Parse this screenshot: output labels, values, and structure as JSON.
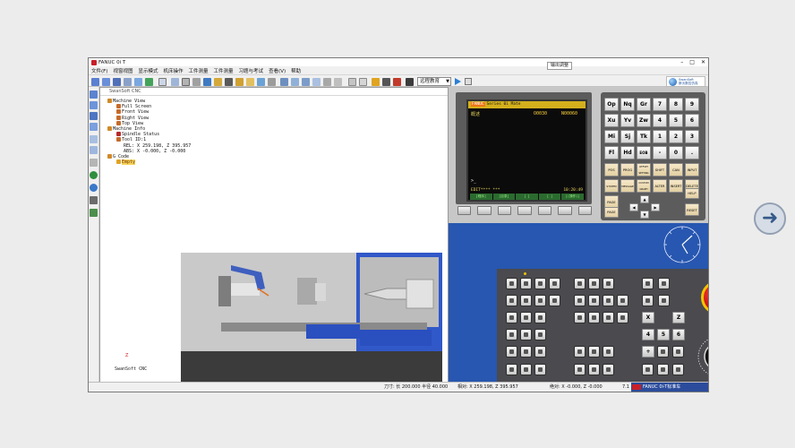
{
  "window": {
    "title": "FANUC 0i T"
  },
  "menu": [
    "文件(F)",
    "视窗视图",
    "显示模式",
    "机床操作",
    "工件测量",
    "工件测量",
    "习题与考试",
    "查看(V)",
    "帮助"
  ],
  "toolbar": {
    "mode_select": "远程教育",
    "top_button": "输出调整"
  },
  "brand": {
    "line1": "SwanSoft",
    "line2": "斯沃数控仿真"
  },
  "viewport": {
    "title": "SwanSoft CNC",
    "tree": [
      {
        "label": "Machine View",
        "level": 0
      },
      {
        "label": "Full Screen",
        "level": 1
      },
      {
        "label": "Front View",
        "level": 1
      },
      {
        "label": "Right View",
        "level": 1
      },
      {
        "label": "Top View",
        "level": 1
      },
      {
        "label": "Machine Info",
        "level": 0
      },
      {
        "label": "Spindle Status",
        "level": 1
      },
      {
        "label": "Tool ID:1",
        "level": 1
      },
      {
        "label": "REL: X 259.198, Z 395.957",
        "level": 1
      },
      {
        "label": "ABS: X  -0.000, Z  -0.000",
        "level": 1
      },
      {
        "label": "G Code",
        "level": 0
      },
      {
        "label": "Empty",
        "level": 1,
        "highlight": true
      }
    ],
    "axis_label": "Z",
    "footer": "SwanSoft CNC"
  },
  "cnc_screen": {
    "header_tag": "FANUC",
    "header": "Series 0i Mate",
    "mode": "概述",
    "o_number": "O0030",
    "n_number": "N00060",
    "prompt": ">_",
    "status": "EDIT**** ***",
    "time": "10:20:49",
    "softkeys": [
      "[程序]",
      "[目录]",
      "[ ]",
      "[ ]",
      "[(操作)]"
    ]
  },
  "mdi_keys": {
    "row1": [
      "Op",
      "Nq",
      "Gr",
      "7",
      "8",
      "9"
    ],
    "row2": [
      "Xu",
      "Yv",
      "Zw",
      "4",
      "5",
      "6"
    ],
    "row3": [
      "Mi",
      "Sj",
      "Tk",
      "1",
      "2",
      "3"
    ],
    "row4": [
      "Fl",
      "Hd",
      "EOB",
      "-",
      "0",
      "."
    ],
    "row5": [
      "POS",
      "PROG",
      "OFFSET SETTING",
      "SHIFT",
      "CAN",
      "INPUT"
    ],
    "row6": [
      "SYSTEM",
      "MESSAGE",
      "CUSTOM GRAPH",
      "ALTER",
      "INSERT",
      "DELETE"
    ],
    "row7": [
      "PAGE",
      "PAGE",
      "HELP",
      "RESET"
    ]
  },
  "op_keys": {
    "x": "X",
    "z": "Z",
    "n4": "4",
    "n5": "5",
    "n6": "6",
    "plus": "+"
  },
  "status_bar": {
    "left": "刀寸: 长 200.000  半径 40.000",
    "mid": "相对: X 259.198, Z 395.957",
    "abs": "绝对: X -0.000, Z -0.000",
    "brand": "FANUC 0i-T标准车",
    "page": "7.1"
  },
  "colors": {
    "cnc_blue": "#2757b0",
    "estop_red": "#c01010",
    "viewport_blue": "#3158c8"
  }
}
